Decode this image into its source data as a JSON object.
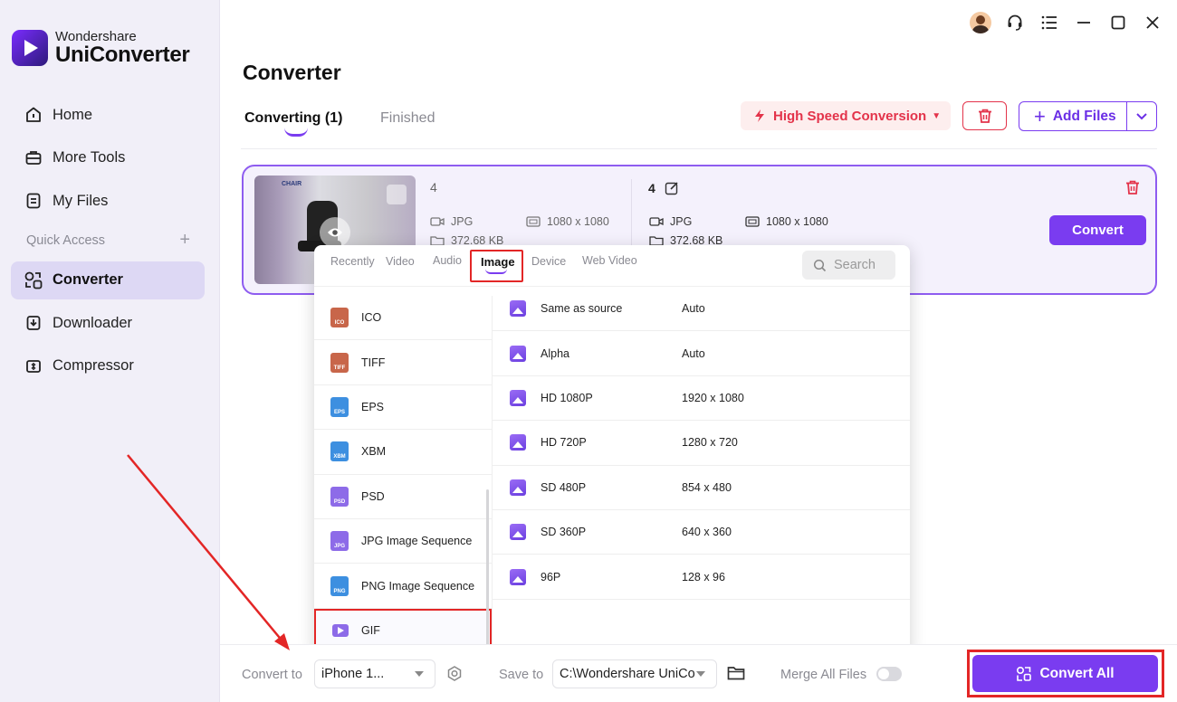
{
  "app": {
    "brand_small": "Wondershare",
    "brand_big": "UniConverter"
  },
  "sidebar": {
    "items": [
      {
        "label": "Home",
        "icon": "home-icon"
      },
      {
        "label": "More Tools",
        "icon": "toolbox-icon"
      },
      {
        "label": "My Files",
        "icon": "files-icon"
      }
    ],
    "quick_access": "Quick Access",
    "items2": [
      {
        "label": "Converter",
        "icon": "converter-icon",
        "active": true
      },
      {
        "label": "Downloader",
        "icon": "downloader-icon"
      },
      {
        "label": "Compressor",
        "icon": "compressor-icon"
      }
    ]
  },
  "header": {
    "title": "Converter",
    "tab_converting": "Converting (1)",
    "tab_finished": "Finished",
    "high_speed": "High Speed Conversion",
    "add_files": "Add Files"
  },
  "file": {
    "source_name": "4",
    "source_format": "JPG",
    "source_resolution": "1080 x 1080",
    "source_size": "372.68 KB",
    "target_name": "4",
    "target_format": "JPG",
    "target_resolution": "1080 x 1080",
    "target_size": "372.68 KB",
    "convert_label": "Convert",
    "thumb_logo": "CHAIR"
  },
  "dropdown": {
    "tabs": [
      "Recently",
      "Video",
      "Audio",
      "Image",
      "Device",
      "Web Video"
    ],
    "active_tab": "Image",
    "search_placeholder": "Search",
    "formats": [
      {
        "label": "ICO",
        "badge": "ICO",
        "color": "#c8664a"
      },
      {
        "label": "TIFF",
        "badge": "TIFF",
        "color": "#c8664a"
      },
      {
        "label": "EPS",
        "badge": "EPS",
        "color": "#3d8fe0"
      },
      {
        "label": "XBM",
        "badge": "XBM",
        "color": "#3d8fe0"
      },
      {
        "label": "PSD",
        "badge": "PSD",
        "color": "#8d6be8"
      },
      {
        "label": "JPG Image Sequence",
        "badge": "JPG",
        "color": "#8d6be8"
      },
      {
        "label": "PNG Image Sequence",
        "badge": "PNG",
        "color": "#3d8fe0"
      },
      {
        "label": "GIF",
        "badge": "",
        "color": "#8d6be8",
        "selected": true
      }
    ],
    "presets": [
      {
        "name": "Same as source",
        "value": "Auto"
      },
      {
        "name": "Alpha",
        "value": "Auto"
      },
      {
        "name": "HD 1080P",
        "value": "1920 x 1080"
      },
      {
        "name": "HD 720P",
        "value": "1280 x 720"
      },
      {
        "name": "SD 480P",
        "value": "854 x 480"
      },
      {
        "name": "SD 360P",
        "value": "640 x 360"
      },
      {
        "name": "96P",
        "value": "128 x 96"
      }
    ]
  },
  "bottom": {
    "convert_to_label": "Convert to",
    "convert_to_value": "iPhone 1...",
    "save_to_label": "Save to",
    "save_to_value": "C:\\Wondershare UniCo",
    "merge_label": "Merge All Files",
    "convert_all": "Convert All"
  },
  "colors": {
    "accent": "#7a3cf0",
    "danger": "#e3334a",
    "highlight": "#e32626"
  }
}
